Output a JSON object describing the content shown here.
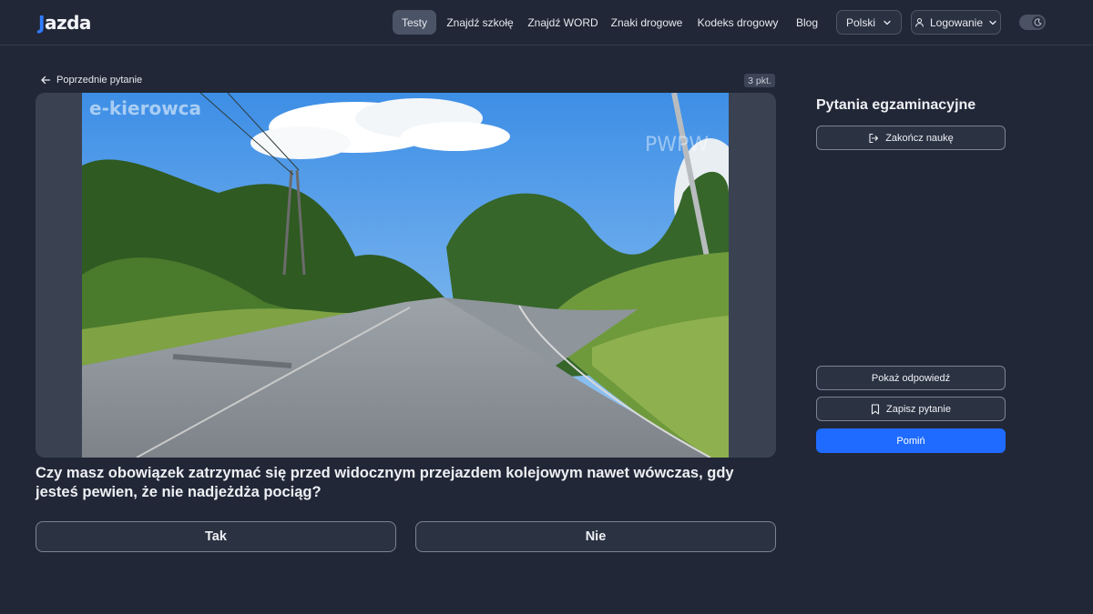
{
  "header": {
    "logo": {
      "mark": "J",
      "text": "azda"
    },
    "nav": [
      "Testy",
      "Znajdź szkołę",
      "Znajdź WORD",
      "Znaki drogowe",
      "Kodeks drogowy",
      "Blog"
    ],
    "active_nav": "Testy",
    "language": "Polski",
    "login": "Logowanie",
    "icons": {
      "language": "chevron-down-icon",
      "login": "user-icon",
      "theme": "moon-icon"
    }
  },
  "question_panel": {
    "back_label": "Poprzednie pytanie",
    "points": "3 pkt.",
    "media": {
      "watermark_left": "e-kierowca",
      "watermark_right": "PWPW"
    },
    "question_text": "Czy masz obowiązek zatrzymać się przed widocznym przejazdem kolejowym nawet wówczas, gdy jesteś pewien, że nie nadjeżdża pociąg?",
    "answers": [
      "Tak",
      "Nie"
    ]
  },
  "sidebar": {
    "title": "Pytania egzaminacyjne",
    "finish_label": "Zakończ naukę",
    "show_answer_label": "Pokaż odpowiedź",
    "save_label": "Zapisz pytanie",
    "skip_label": "Pomiń"
  },
  "colors": {
    "background": "#212736",
    "active_nav": "#4b5466",
    "primary": "#1f6bff",
    "logo_accent": "#2f7bff"
  }
}
